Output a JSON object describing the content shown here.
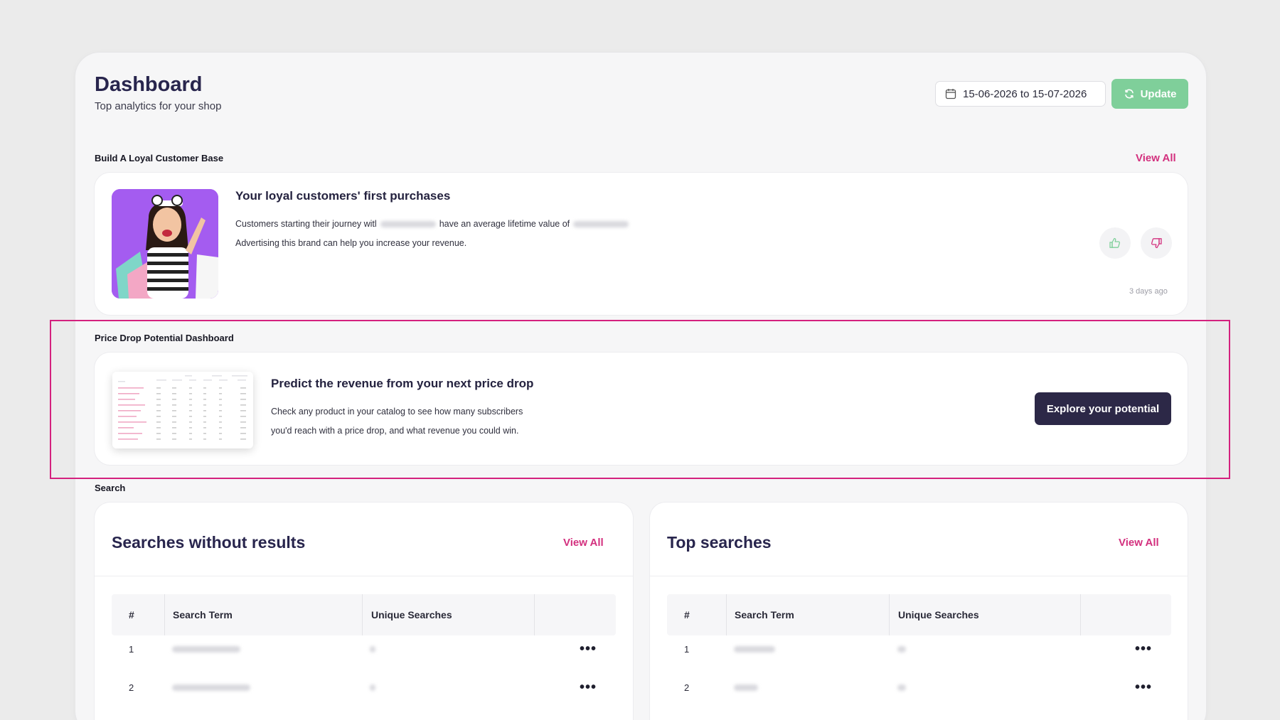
{
  "header": {
    "title": "Dashboard",
    "subtitle": "Top analytics for your shop",
    "date_range": "15-06-2026 to 15-07-2026",
    "update_label": "Update"
  },
  "loyal": {
    "section_label": "Build A Loyal Customer Base",
    "view_all": "View All",
    "title": "Your loyal customers' first purchases",
    "line1_a": "Customers starting their journey witl",
    "line1_b": "have an average lifetime value of",
    "line2": "Advertising this brand can help you increase your revenue.",
    "timestamp": "3 days ago"
  },
  "price_drop": {
    "section_label": "Price Drop Potential Dashboard",
    "title": "Predict the revenue from your next price drop",
    "line1": "Check any product in your catalog to see how many subscribers",
    "line2": "you'd reach with a price drop, and what revenue you could win.",
    "cta": "Explore your potential"
  },
  "search": {
    "section_label": "Search",
    "no_results": {
      "title": "Searches without results",
      "view_all": "View All",
      "columns": [
        "#",
        "Search Term",
        "Unique Searches"
      ],
      "rows": [
        {
          "index": "1"
        },
        {
          "index": "2"
        }
      ]
    },
    "top": {
      "title": "Top searches",
      "view_all": "View All",
      "columns": [
        "#",
        "Search Term",
        "Unique Searches"
      ],
      "rows": [
        {
          "index": "1"
        },
        {
          "index": "2"
        }
      ]
    }
  },
  "colors": {
    "accent": "#d3307e",
    "update_green": "#7fcf9a",
    "primary_dark": "#2c2847",
    "highlight": "#d4217e"
  }
}
